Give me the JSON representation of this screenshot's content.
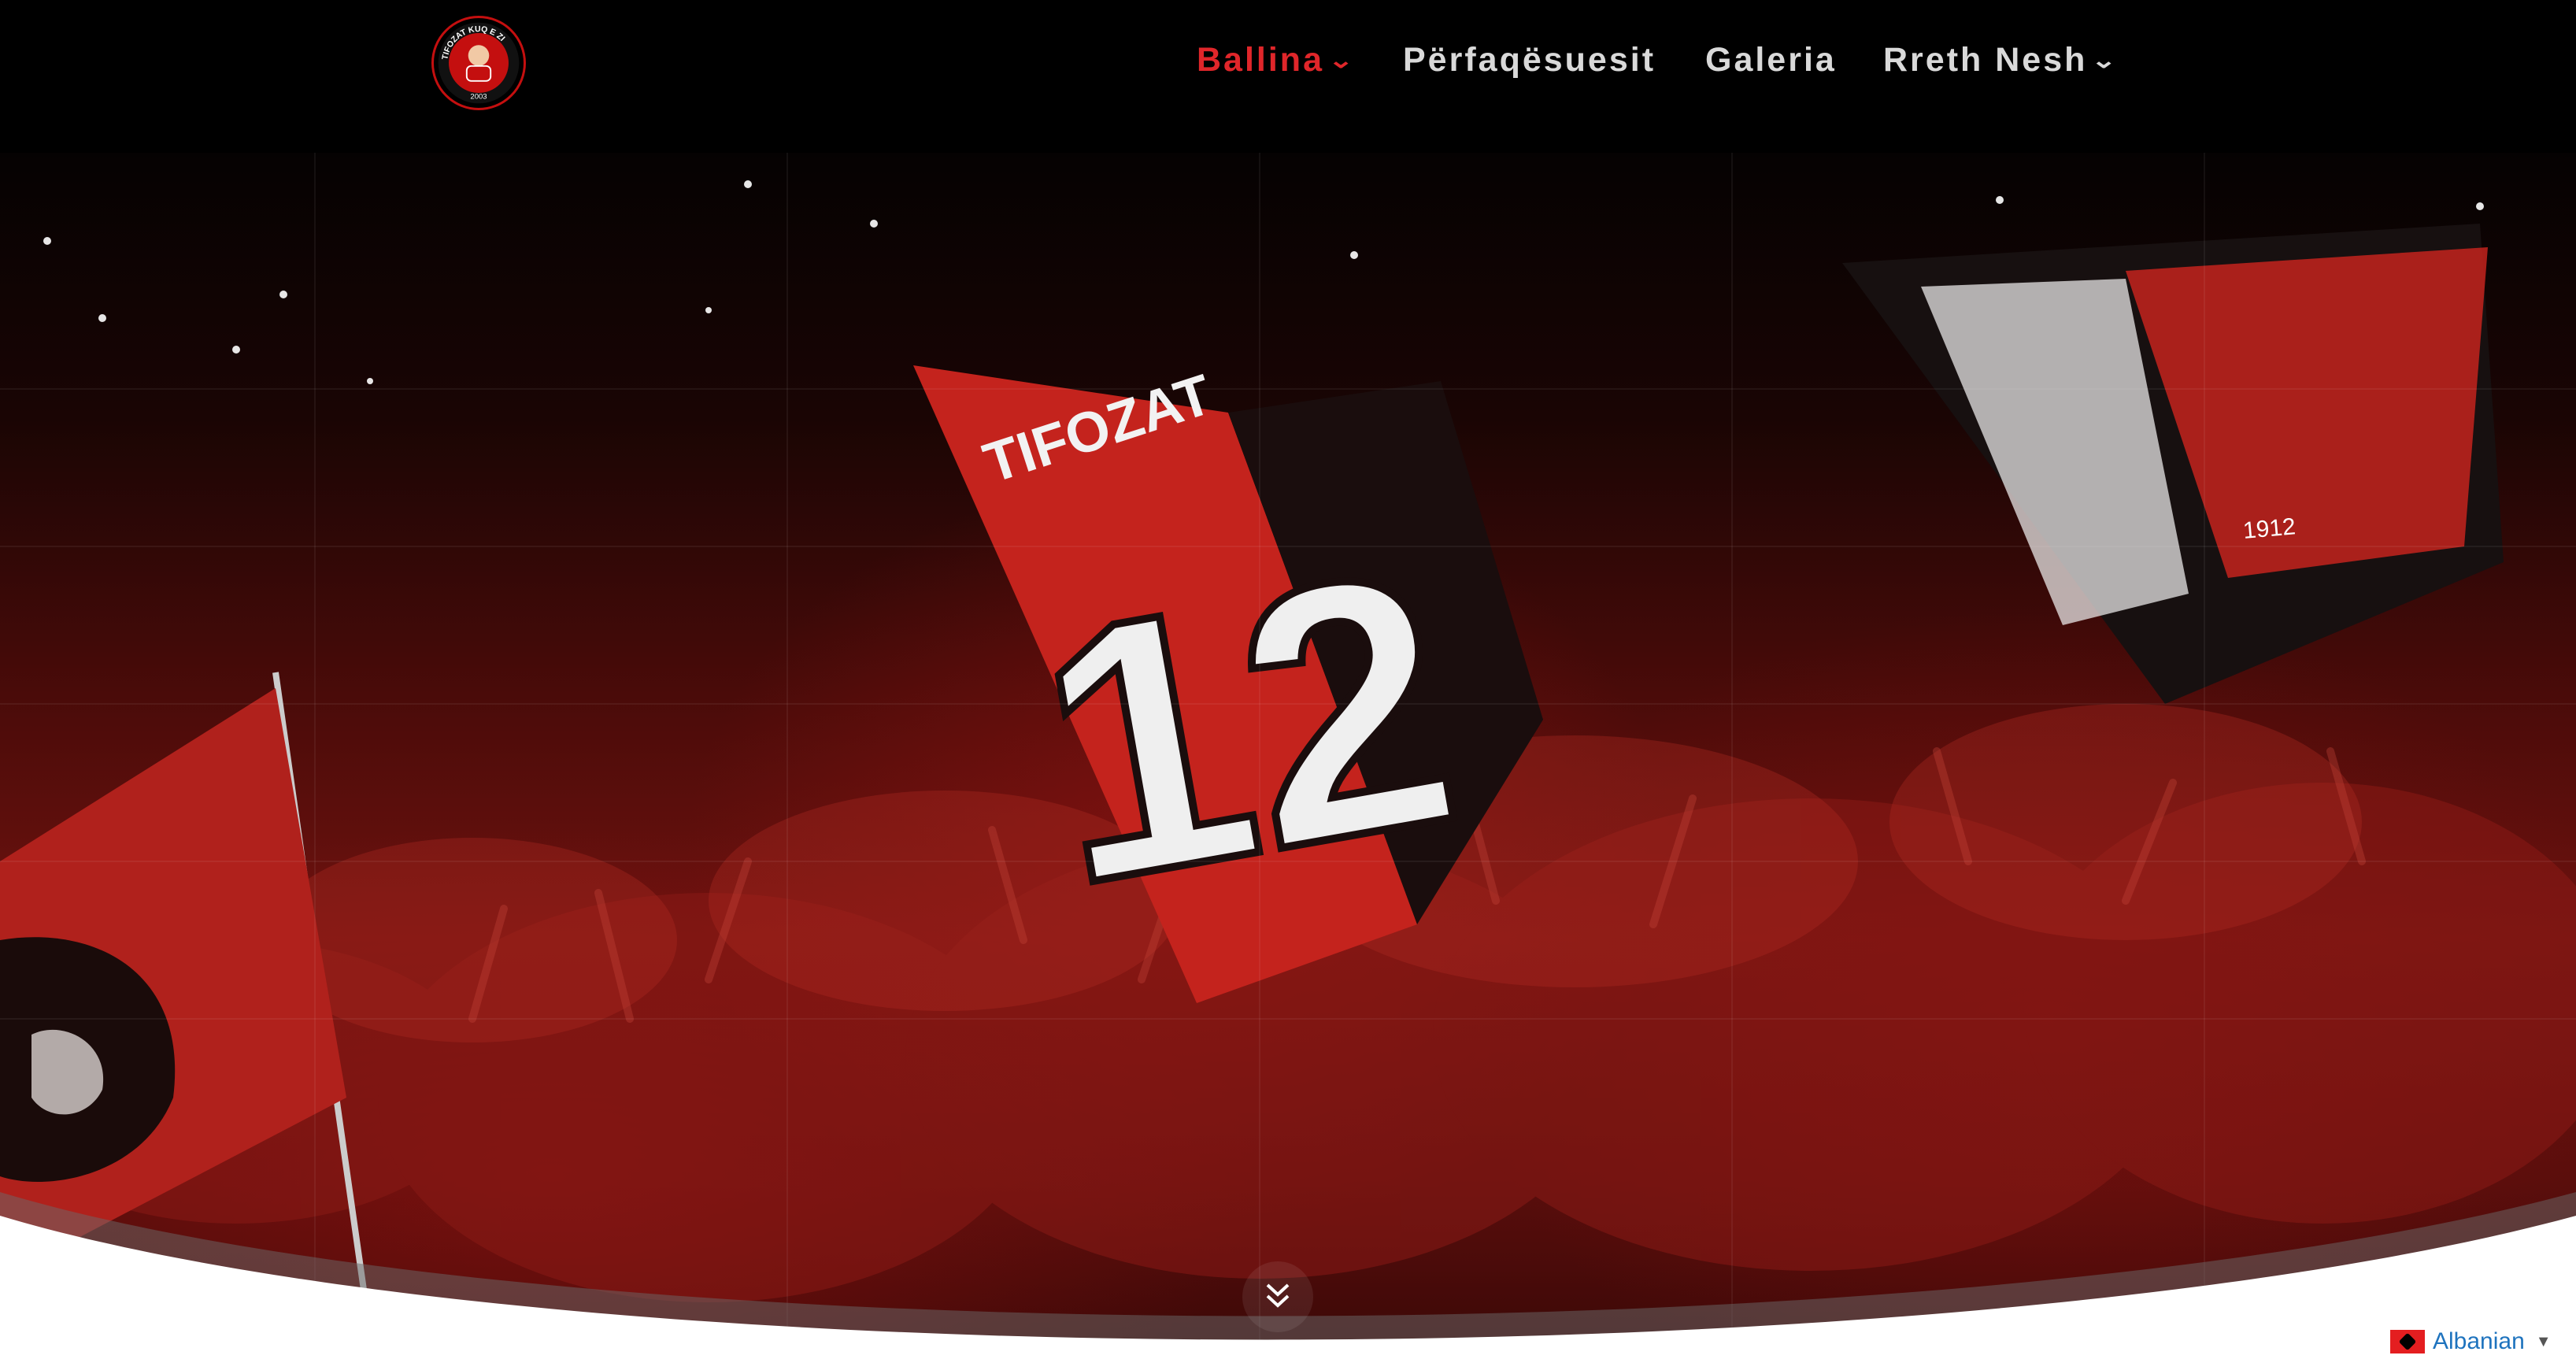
{
  "header": {
    "logo_alt": "TIFOZAT KUQ E ZI 2003",
    "logo_text_top": "TIFOZAT KUQ E ZI",
    "logo_text_year": "2003"
  },
  "nav": {
    "items": [
      {
        "label": "Ballina",
        "active": true,
        "has_dropdown": true
      },
      {
        "label": "Përfaqësuesit",
        "active": false,
        "has_dropdown": false
      },
      {
        "label": "Galeria",
        "active": false,
        "has_dropdown": false
      },
      {
        "label": "Rreth Nesh",
        "active": false,
        "has_dropdown": true
      }
    ],
    "chevron": "⌄"
  },
  "hero": {
    "flag_number": "12",
    "flag_word": "TIFOZAT",
    "flag_right_number": "1912"
  },
  "language": {
    "label": "Albanian",
    "arrow": "▼"
  },
  "colors": {
    "accent": "#e0262a",
    "nav_text": "#d9d9d9",
    "header_bg": "#000000"
  }
}
